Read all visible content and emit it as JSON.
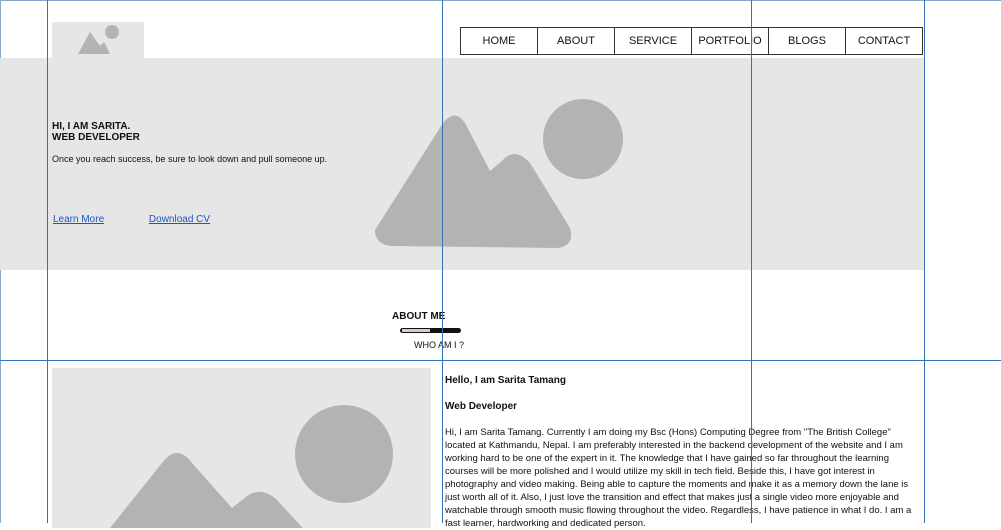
{
  "nav": {
    "items": [
      "HOME",
      "ABOUT",
      "SERVICE",
      "PORTFOLIO",
      "BLOGS",
      "CONTACT"
    ]
  },
  "hero": {
    "greeting": "HI, I AM SARITA.",
    "role": "WEB DEVELOPER",
    "quote": "Once you reach success, be sure to look down and pull someone up.",
    "learn_more": "Learn More",
    "download_cv": "Download CV"
  },
  "about": {
    "title": "ABOUT ME",
    "subtitle": "WHO AM I ?",
    "hello": "Hello, I am Sarita Tamang",
    "role": "Web Developer",
    "bio": "Hi, I am Sarita Tamang. Currently I am doing my Bsc (Hons) Computing Degree from \"The British College\" located at Kathmandu, Nepal. I am preferably interested in the backend development of the website and I am working hard to be one of the expert in it. The knowledge that I have gained so far throughout the learning courses will be more polished and I would utilize my skill in tech field. Beside this, I have got interest in photography and video making. Being able to capture the moments and make it as a memory down the lane is just worth all of it. Also, I just love the transition and effect that makes just a single video more enjoyable and watchable through smooth music flowing throughout the video. Regardless, I have patience in what I do. I am a fast learner, hardworking and dedicated person."
  },
  "colors": {
    "placeholder_bg": "#e6e6e6",
    "placeholder_shape": "#b3b3b3",
    "link": "#1a56c6",
    "guide": "#3572b8"
  }
}
